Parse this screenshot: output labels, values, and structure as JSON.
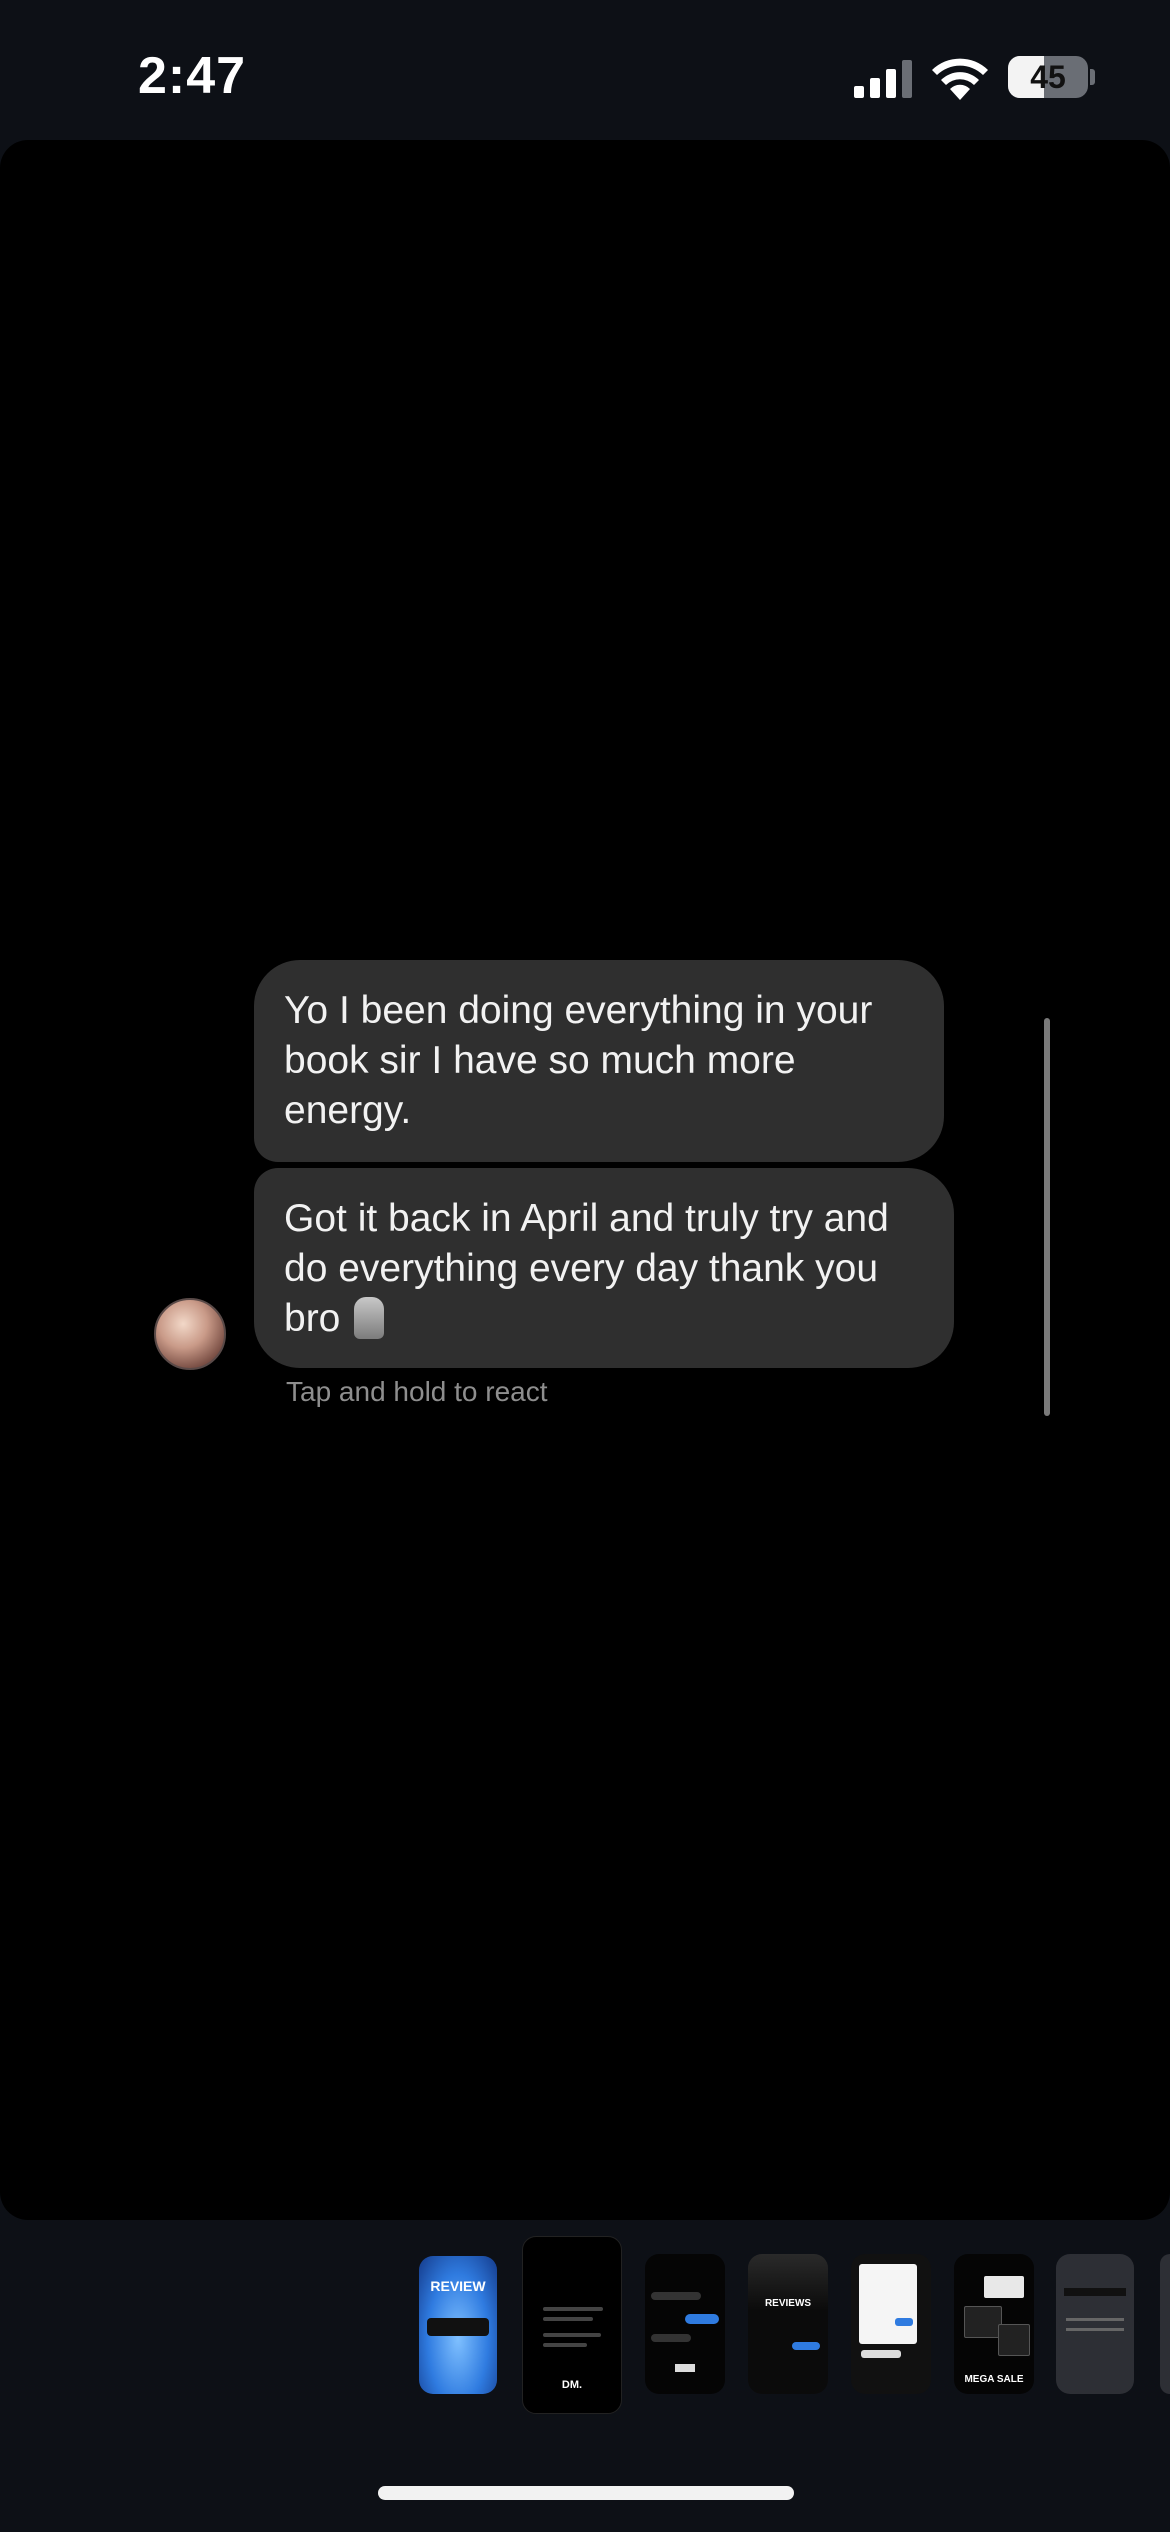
{
  "status_bar": {
    "time": "2:47",
    "battery_level": "45",
    "battery_fraction": 0.45,
    "icons": [
      "cellular-signal-icon",
      "wifi-icon",
      "battery-icon"
    ]
  },
  "messages": [
    {
      "text": "Yo I been doing everything in your book sir I have so much more energy."
    },
    {
      "text": "Got it back in April and truly try and do everything every day thank you bro",
      "emoji": "moai-emoji"
    }
  ],
  "hint": "Tap and hold to react",
  "thumbnails": [
    {
      "label": "REVIEW",
      "selected": false
    },
    {
      "label": "DM.",
      "selected": true
    },
    {
      "label": "",
      "selected": false
    },
    {
      "label": "REVIEWS",
      "selected": false
    },
    {
      "label": "",
      "selected": false
    },
    {
      "label": "MEGA SALE",
      "selected": false
    },
    {
      "label": "",
      "selected": false
    },
    {
      "label": "",
      "selected": false
    }
  ],
  "colors": {
    "background": "#0d1016",
    "viewer": "#000000",
    "bubble": "#2f2f2f",
    "accent_blue": "#2f7be0"
  }
}
